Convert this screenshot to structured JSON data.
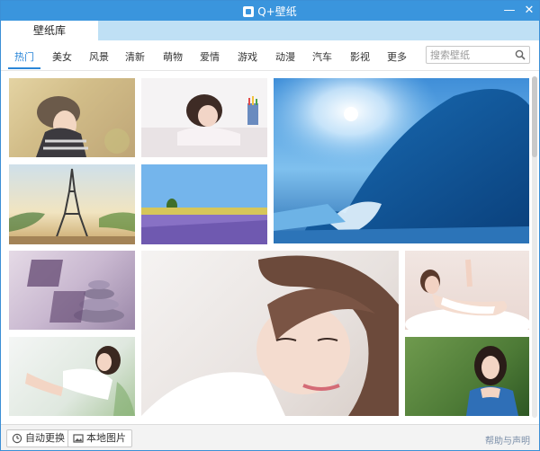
{
  "window": {
    "title": "Q+壁纸",
    "minimize_label": "—",
    "close_label": "✕"
  },
  "tabs": {
    "main": "壁纸库"
  },
  "categories": [
    "热门",
    "美女",
    "风景",
    "清新",
    "萌物",
    "爱情",
    "游戏",
    "动漫",
    "汽车",
    "影视",
    "更多"
  ],
  "active_category": "热门",
  "search": {
    "placeholder": "搜索壁纸",
    "value": ""
  },
  "gallery": {
    "tiles": [
      {
        "name": "wallpaper-girl-hat"
      },
      {
        "name": "wallpaper-girl-drawing"
      },
      {
        "name": "wallpaper-ocean-wave"
      },
      {
        "name": "wallpaper-eiffel-tower"
      },
      {
        "name": "wallpaper-lavender-field"
      },
      {
        "name": "wallpaper-stones-text"
      },
      {
        "name": "wallpaper-girl-closeup"
      },
      {
        "name": "wallpaper-girl-bath"
      },
      {
        "name": "wallpaper-girl-white-shirt"
      },
      {
        "name": "wallpaper-girl-green-bg"
      }
    ]
  },
  "footer": {
    "auto_change": "自动更换",
    "local_images": "本地图片",
    "help": "帮助与声明"
  },
  "colors": {
    "titlebar": "#3a95dd",
    "accent": "#2a86d8",
    "tabbar": "#bfe0f5"
  }
}
